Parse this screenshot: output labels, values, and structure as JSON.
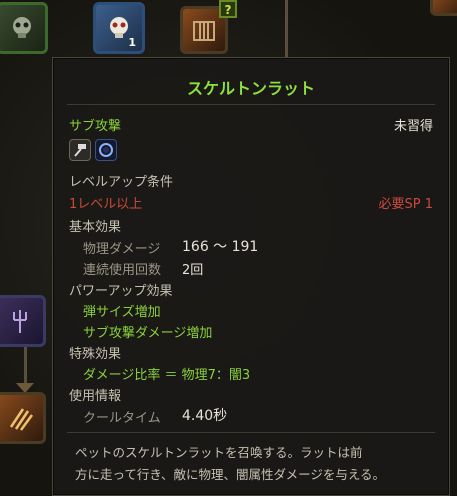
{
  "title": "スケルトンラット",
  "category": {
    "label": "サブ攻撃",
    "status": "未習得"
  },
  "weapon_icons": [
    "hammer-icon",
    "orb-icon"
  ],
  "levelup": {
    "heading": "レベルアップ条件",
    "condition": "1レベル以上",
    "sp": "必要SP 1"
  },
  "basic": {
    "heading": "基本効果",
    "damage_label": "物理ダメージ",
    "damage_value": "166 ～ 191",
    "uses_label": "連続使用回数",
    "uses_value": "2回"
  },
  "powerup": {
    "heading": "パワーアップ効果",
    "items": [
      "弾サイズ増加",
      "サブ攻撃ダメージ増加"
    ]
  },
  "special": {
    "heading": "特殊効果",
    "ratio": "ダメージ比率 ＝ 物理7：闇3"
  },
  "usage": {
    "heading": "使用情報",
    "cooldown_label": "クールタイム",
    "cooldown_value": "4.40秒"
  },
  "description_line1": "ペットのスケルトンラットを召喚する。ラットは前",
  "description_line2": "方に走って行き、敵に物理、闇属性ダメージを与える。",
  "tiles": {
    "skull_count": "1",
    "question_badge": "?"
  },
  "colors": {
    "title": "#8ce03f",
    "green_text": "#8ad13a",
    "red_text": "#c94a3a",
    "tooltip_bg": "#1a1917"
  }
}
